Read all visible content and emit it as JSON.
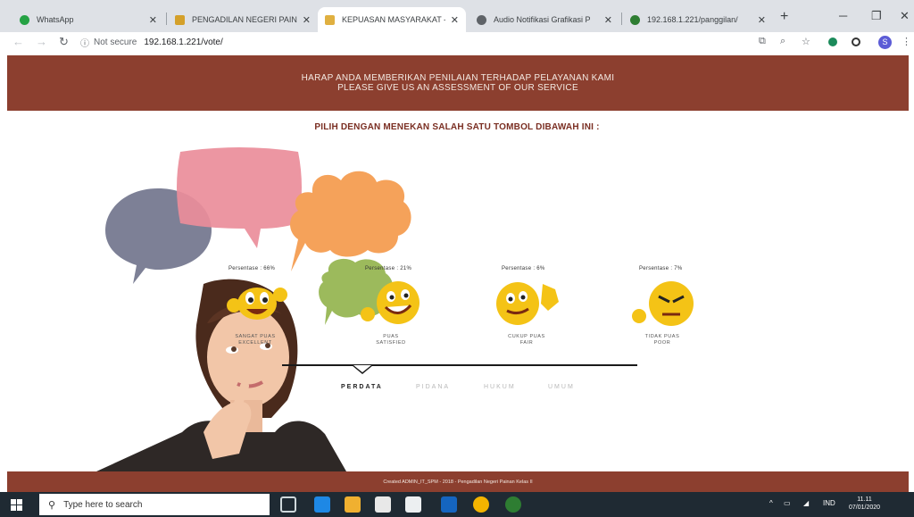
{
  "browser": {
    "tabs": [
      {
        "label": "WhatsApp",
        "favicon_color": "#25a244"
      },
      {
        "label": "PENGADILAN NEGERI PAINAN",
        "favicon_color": "#d4a02a"
      },
      {
        "label": "KEPUASAN MASYARAKAT - P",
        "favicon_color": "#e0b040",
        "active": true
      },
      {
        "label": "Audio Notifikasi Grafikasi P",
        "favicon_color": "#5f6368"
      },
      {
        "label": "192.168.1.221/panggilan/",
        "favicon_color": "#2e7d32"
      }
    ],
    "address": {
      "secure_label": "Not secure",
      "url": "192.168.1.221/vote/"
    }
  },
  "page": {
    "banner_line1": "HARAP ANDA MEMBERIKAN PENILAIAN TERHADAP PELAYANAN KAMI",
    "banner_line2": "PLEASE GIVE US AN ASSESSMENT OF OUR SERVICE",
    "instruction": "PILIH DENGAN MENEKAN SALAH SATU TOMBOL DIBAWAH INI :",
    "options": [
      {
        "percent_label": "Persentase : 66%",
        "label1": "SANGAT PUAS",
        "label2": "EXCELLENT"
      },
      {
        "percent_label": "Persentase : 21%",
        "label1": "PUAS",
        "label2": "SATISFIED"
      },
      {
        "percent_label": "Persentase : 6%",
        "label1": "CUKUP PUAS",
        "label2": "FAIR"
      },
      {
        "percent_label": "Persentase : 7%",
        "label1": "TIDAK PUAS",
        "label2": "POOR"
      }
    ],
    "categories": [
      "PERDATA",
      "PIDANA",
      "HUKUM",
      "UMUM"
    ],
    "footer": "Created ADMIN_IT_SPM - 2018 - Pengadilan Negeri Painan Kelas II"
  },
  "taskbar": {
    "search_placeholder": "Type here to search",
    "lang": "IND",
    "time": "11.11",
    "date": "07/01/2020"
  },
  "colors": {
    "banner": "#8c3f2f",
    "bubble_pink": "#ea8d9a",
    "bubble_slate": "#7d8096",
    "bubble_orange": "#f5a25a",
    "bubble_green": "#9cba5c",
    "emoji": "#f4c316"
  }
}
